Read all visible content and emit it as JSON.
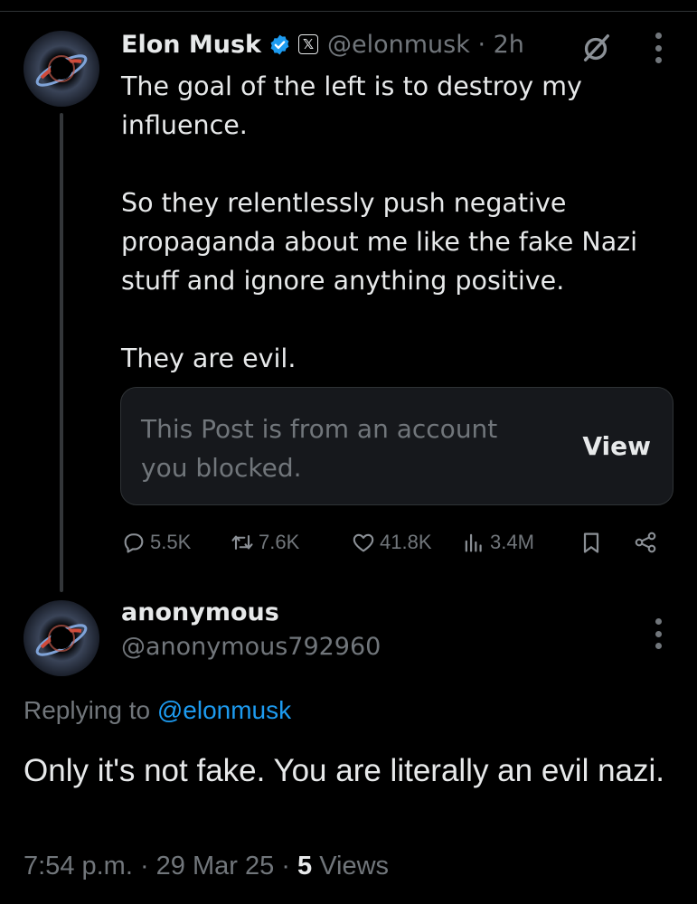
{
  "post": {
    "author_name": "Elon Musk",
    "x_badge": "𝕏",
    "handle_time": "@elonmusk · 2h",
    "paragraphs": [
      "The goal of the left is to destroy my influence.",
      "So they relentlessly push negative propaganda about me like the fake Nazi stuff and ignore anything positive.",
      "They are evil."
    ],
    "blocked_notice": "This Post is from an account you blocked.",
    "blocked_view_label": "View",
    "stats": {
      "replies": "5.5K",
      "reposts": "7.6K",
      "likes": "41.8K",
      "views": "3.4M"
    }
  },
  "reply": {
    "author_name": "anonymous",
    "handle": "@anonymous792960",
    "replying_prefix": "Replying to ",
    "replying_to": "@elonmusk",
    "text": "Only it's not fake. You are literally an evil nazi.",
    "time_date": "7:54 p.m. · 29 Mar 25 · ",
    "views_count": "5",
    "views_label": " Views"
  },
  "icons": {
    "verified": "verified-badge-icon",
    "grok": "grok-icon",
    "more": "more-dots-icon",
    "reply": "reply-icon",
    "repost": "repost-icon",
    "like": "heart-icon",
    "views": "views-bar-chart-icon",
    "bookmark": "bookmark-icon",
    "share": "share-icon"
  },
  "colors": {
    "background": "#000000",
    "text": "#e7e9ea",
    "muted": "#71767b",
    "link": "#1d9bf0",
    "card": "#16181c"
  }
}
